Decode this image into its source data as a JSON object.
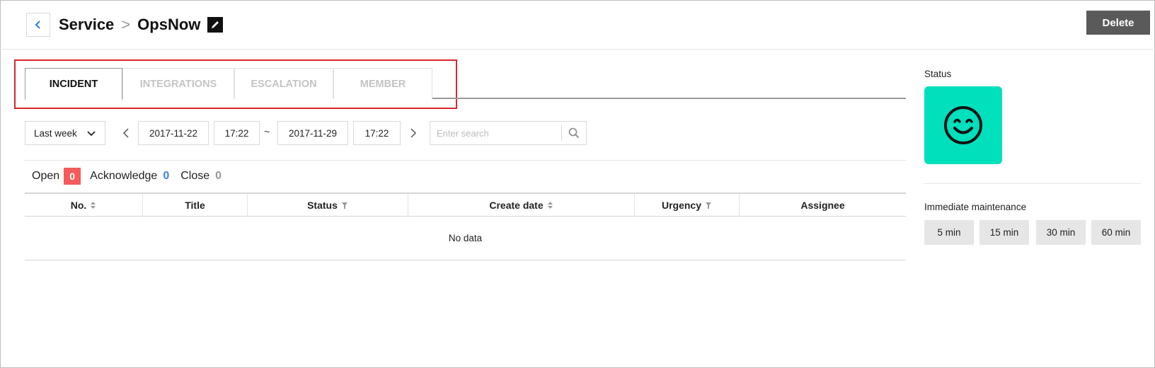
{
  "header": {
    "breadcrumb_root": "Service",
    "breadcrumb_separator": ">",
    "breadcrumb_current": "OpsNow",
    "delete_label": "Delete"
  },
  "tabs": [
    {
      "label": "INCIDENT",
      "active": true
    },
    {
      "label": "INTEGRATIONS",
      "active": false
    },
    {
      "label": "ESCALATION",
      "active": false
    },
    {
      "label": "MEMBER",
      "active": false
    }
  ],
  "filter": {
    "period": "Last week",
    "start_date": "2017-11-22",
    "start_time": "17:22",
    "range_separator": "~",
    "end_date": "2017-11-29",
    "end_time": "17:22",
    "search_placeholder": "Enter search"
  },
  "counts": {
    "open_label": "Open",
    "open_value": "0",
    "ack_label": "Acknowledge",
    "ack_value": "0",
    "close_label": "Close",
    "close_value": "0"
  },
  "table": {
    "columns": [
      "No.",
      "Title",
      "Status",
      "Create date",
      "Urgency",
      "Assignee"
    ],
    "empty_text": "No data"
  },
  "right_panel": {
    "status_label": "Status",
    "status_icon": "smiley-face-icon",
    "maintenance_label": "Immediate maintenance",
    "maintenance_options": [
      "5 min",
      "15 min",
      "30 min",
      "60 min"
    ]
  },
  "colors": {
    "status_tile": "#00e0bc",
    "open_badge": "#f45b5b",
    "ack_count": "#3b82e0",
    "highlight_box": "#d9262b",
    "delete_button": "#5a5a5a"
  }
}
